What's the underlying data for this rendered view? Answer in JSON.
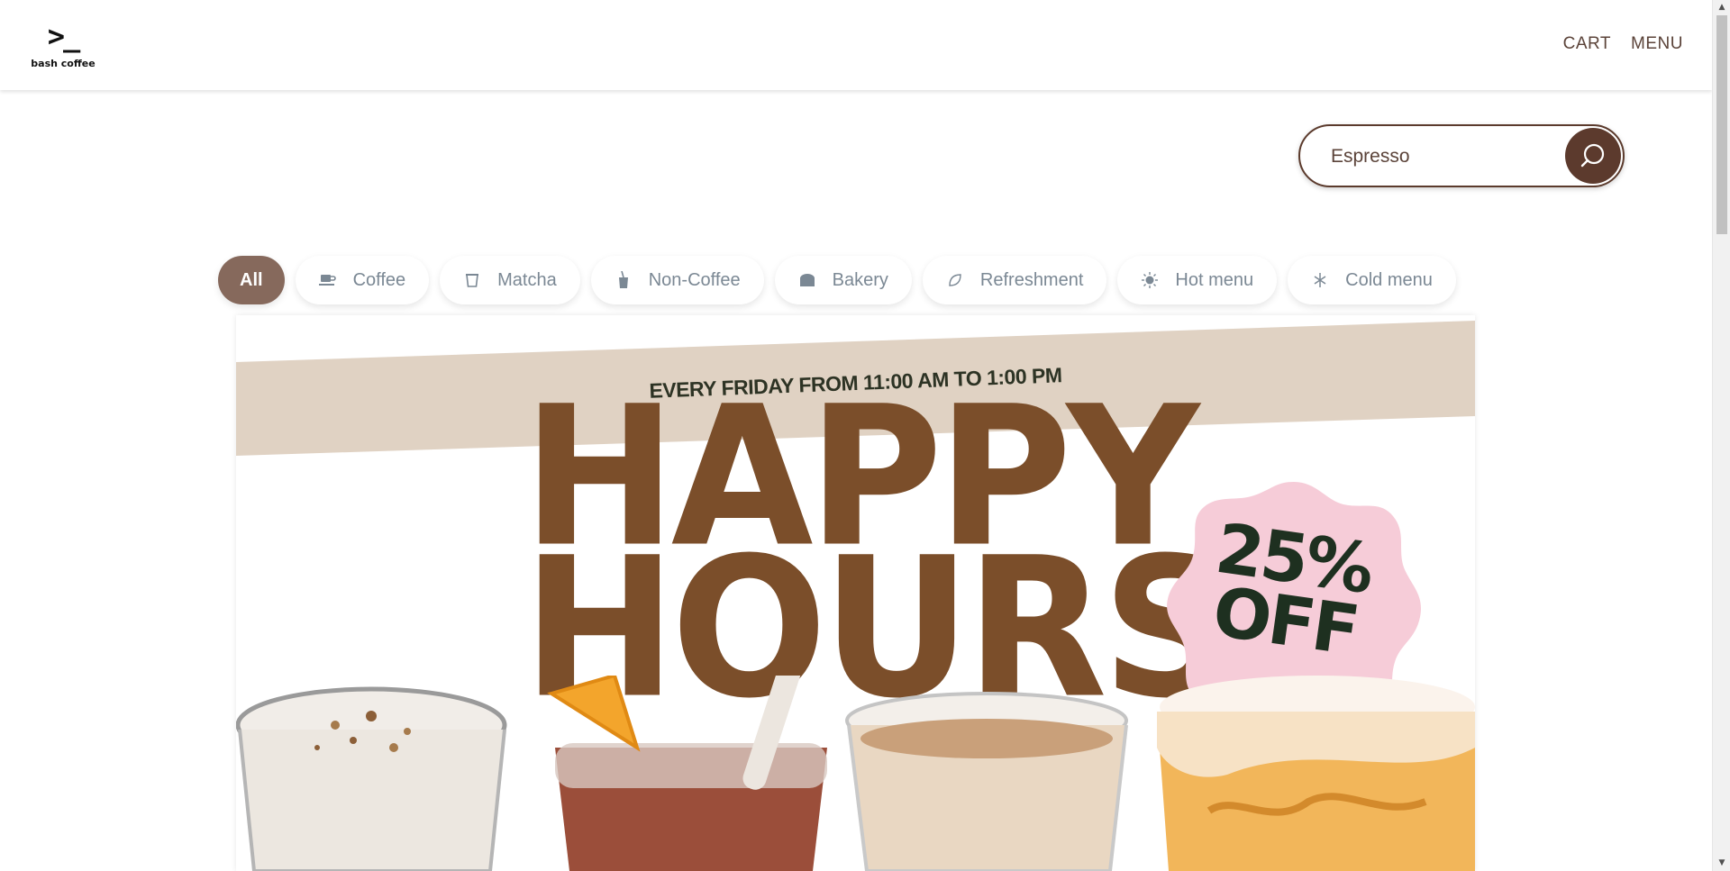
{
  "brand": {
    "logo_mark": ">_",
    "name": "bash coffee"
  },
  "nav": {
    "cart": "CART",
    "menu": "MENU"
  },
  "search": {
    "value": "Espresso",
    "placeholder": ""
  },
  "categories": [
    {
      "label": "All",
      "icon": "none",
      "active": true
    },
    {
      "label": "Coffee",
      "icon": "coffee-cup-icon",
      "active": false
    },
    {
      "label": "Matcha",
      "icon": "cup-icon",
      "active": false
    },
    {
      "label": "Non-Coffee",
      "icon": "drink-icon",
      "active": false
    },
    {
      "label": "Bakery",
      "icon": "bread-icon",
      "active": false
    },
    {
      "label": "Refreshment",
      "icon": "leaf-icon",
      "active": false
    },
    {
      "label": "Hot menu",
      "icon": "sun-icon",
      "active": false
    },
    {
      "label": "Cold menu",
      "icon": "snowflake-icon",
      "active": false
    }
  ],
  "banner": {
    "schedule": "EVERY FRIDAY FROM 11:00 AM TO 1:00 PM",
    "headline_line1": "HAPPY",
    "headline_line2": "HOURS",
    "discount_line1": "25%",
    "discount_line2": "OFF"
  },
  "colors": {
    "accent_brown": "#5c3a2d",
    "active_pill": "#86695c",
    "headline": "#7b4e2a",
    "band": "#e0d2c3",
    "badge_pink": "#f6ccd8",
    "badge_text": "#1e3020"
  }
}
